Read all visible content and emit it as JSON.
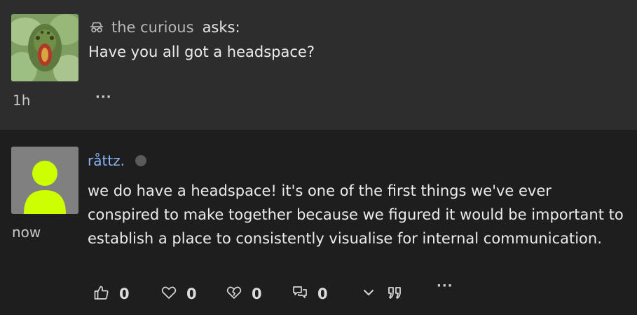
{
  "ask": {
    "asker_name": "the curious",
    "asks_label": "asks:",
    "question": "Have you all got a headspace?",
    "time": "1h",
    "more_label": "···",
    "anon_icon": "incognito-icon"
  },
  "answer": {
    "username": "råttz.",
    "status_color": "#5a5a5a",
    "text": "we do have a headspace! it's one of the first things we've ever conspired to make together because we figured it would be important to establish a place to consistently visualise for internal communication.",
    "time": "now",
    "avatar_color": "#ccff00",
    "actions": {
      "like_count": "0",
      "heart_count": "0",
      "broken_heart_count": "0",
      "comment_count": "0",
      "more_label": "···"
    }
  },
  "colors": {
    "link": "#8ab4f8",
    "ask_bg": "#2d2d2d",
    "answer_bg": "#1e1e1e"
  }
}
